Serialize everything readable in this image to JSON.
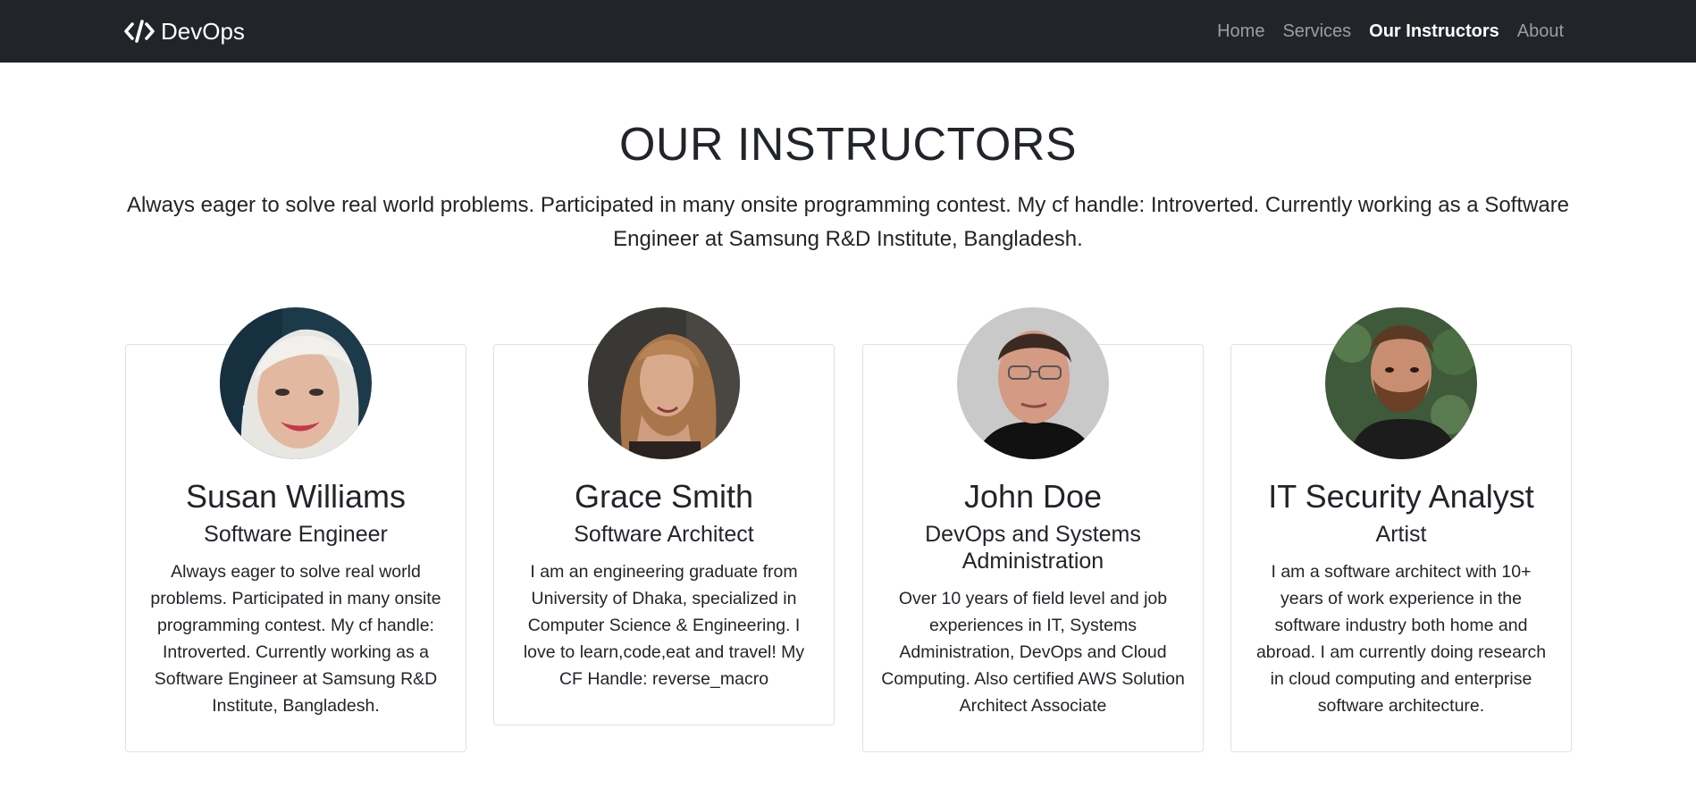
{
  "navbar": {
    "brand": "DevOps",
    "links": [
      {
        "label": "Home",
        "active": false
      },
      {
        "label": "Services",
        "active": false
      },
      {
        "label": "Our Instructors",
        "active": true
      },
      {
        "label": "About",
        "active": false
      }
    ]
  },
  "header": {
    "title": "OUR INSTRUCTORS",
    "lead": "Always eager to solve real world problems. Participated in many onsite programming contest. My cf handle: Introverted. Currently working as a Software Engineer at Samsung R&D Institute, Bangladesh."
  },
  "instructors": [
    {
      "name": "Susan Williams",
      "role": "Software Engineer",
      "bio": "Always eager to solve real world problems. Participated in many onsite programming contest. My cf handle: Introverted. Currently working as a Software Engineer at Samsung R&D Institute, Bangladesh."
    },
    {
      "name": "Grace Smith",
      "role": "Software Architect",
      "bio": "I am an engineering graduate from University of Dhaka, specialized in Computer Science & Engineering. I love to learn,code,eat and travel! My CF Handle: reverse_macro"
    },
    {
      "name": "John Doe",
      "role": "DevOps and Systems Administration",
      "bio": "Over 10 years of field level and job experiences in IT, Systems Administration, DevOps and Cloud Computing. Also certified AWS Solution Architect Associate"
    },
    {
      "name": "IT Security Analyst",
      "role": "Artist",
      "bio": "I am a software architect with 10+ years of work experience in the software industry both home and abroad. I am currently doing research in cloud computing and enterprise software architecture."
    }
  ],
  "colors": {
    "navbar_bg": "#212529",
    "text": "#212529",
    "card_border": "#dfe0e2"
  }
}
